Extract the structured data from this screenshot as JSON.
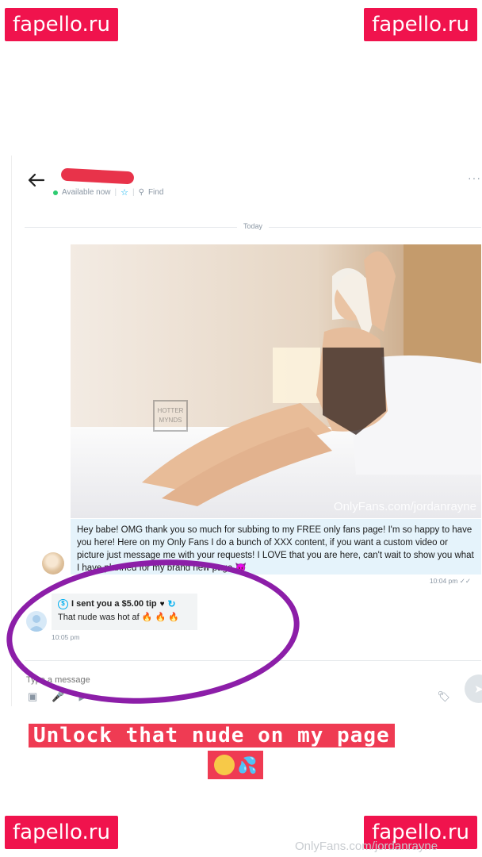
{
  "watermarks": {
    "top_left": "fapello.ru",
    "top_right": "fapello.ru",
    "bottom_left": "fapello.ru",
    "bottom_right": "fapello.ru",
    "bottom_text": "OnlyFans.com/jordanrayne"
  },
  "chat_header": {
    "status": "Available now",
    "find_label": "Find"
  },
  "chat": {
    "date_divider": "Today",
    "photo_watermark": "OnlyFans.com/jordanrayne",
    "outgoing_message": "Hey babe! OMG thank you so much for subbing to my FREE only fans page! I'm so happy to have you here! Here on my Only Fans I do a bunch of XXX content, if you want a custom video or picture just message me with your requests! I LOVE that you are here, can't wait to show you what I have planned for my brand new page 😈",
    "outgoing_time": "10:04 pm",
    "tip_text": "I sent you a $5.00 tip",
    "incoming_message": "That nude was hot af",
    "incoming_time": "10:05 pm",
    "input_placeholder": "Type a message"
  },
  "caption": {
    "text": "Unlock that nude on my page"
  },
  "colors": {
    "accent": "#00aff0",
    "annotation_circle": "#8c1ea8",
    "watermark": "#f0134d",
    "caption_bg": "#ef3b53"
  }
}
